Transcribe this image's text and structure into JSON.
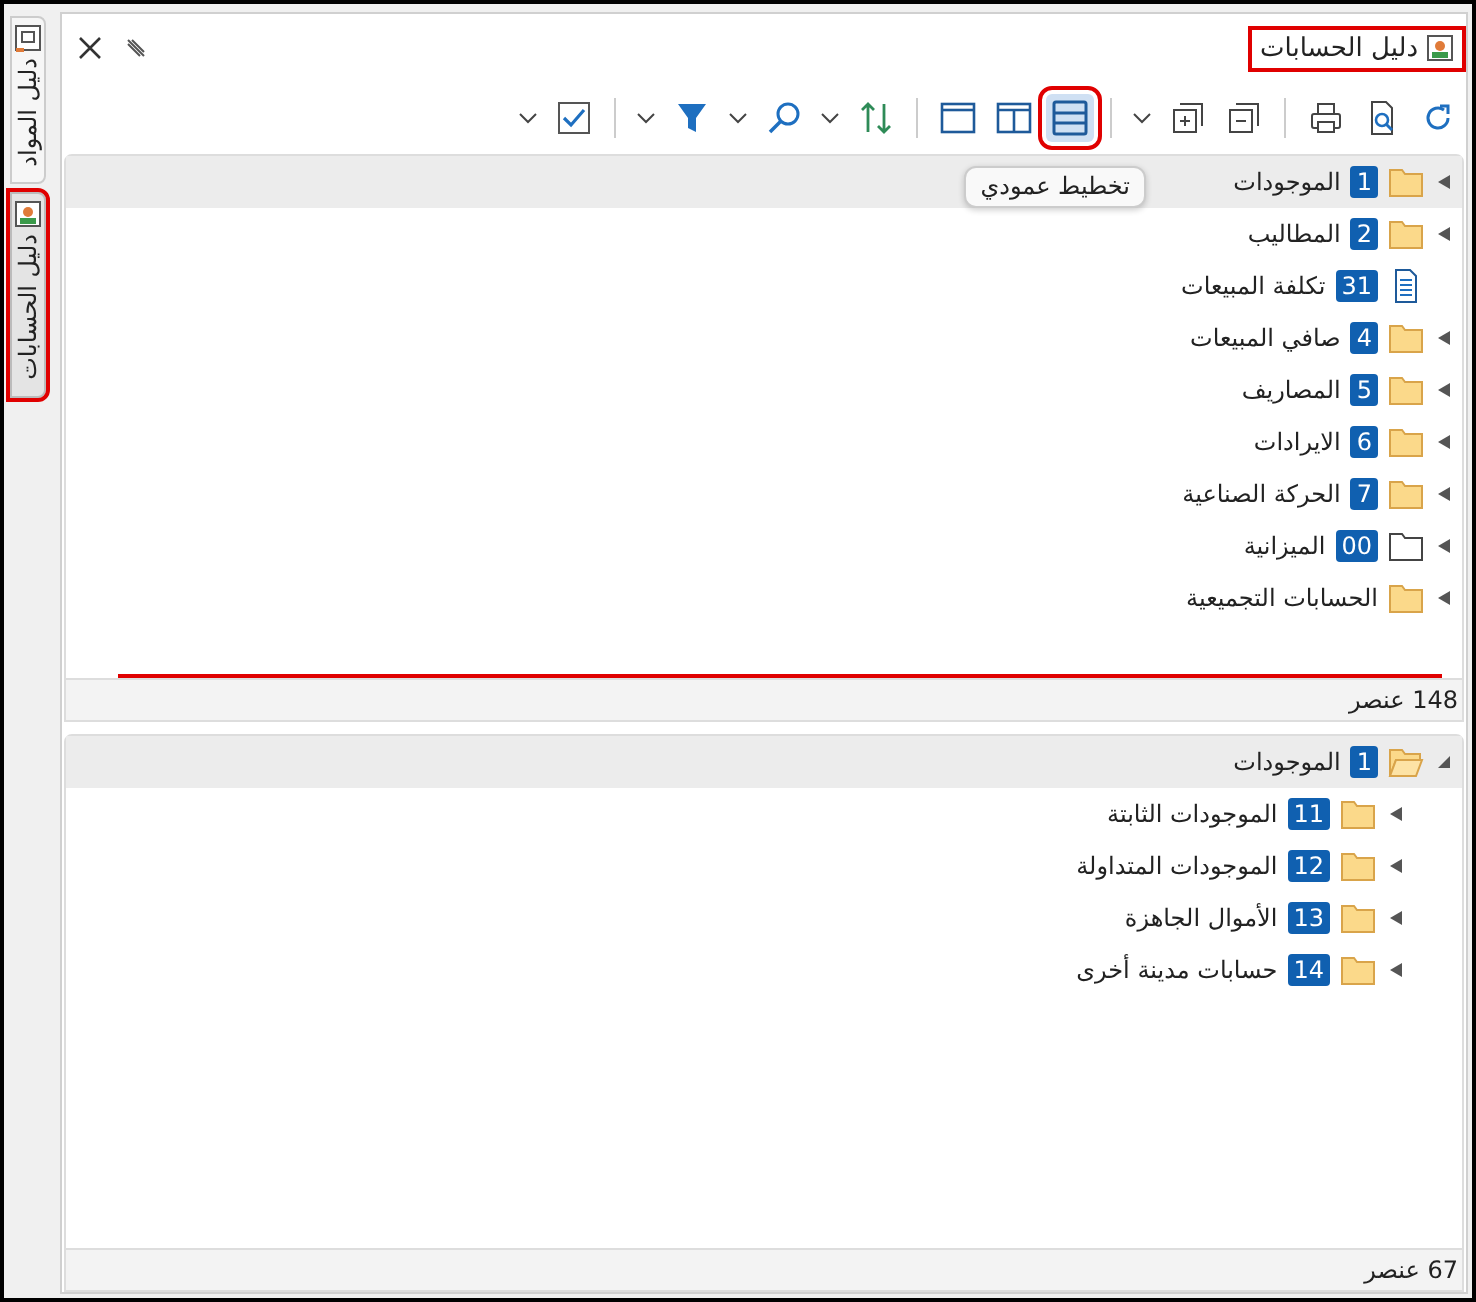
{
  "sidebar_tabs": [
    {
      "label": "دليل المواد",
      "selected": false,
      "highlighted": false
    },
    {
      "label": "دليل الحسابات",
      "selected": true,
      "highlighted": true
    }
  ],
  "panel": {
    "title": "دليل الحسابات",
    "title_highlighted": true
  },
  "toolbar": [
    {
      "kind": "refresh"
    },
    {
      "kind": "print-preview"
    },
    {
      "kind": "print"
    },
    {
      "kind": "separator"
    },
    {
      "kind": "collapse"
    },
    {
      "kind": "expand"
    },
    {
      "kind": "dropdown"
    },
    {
      "kind": "separator"
    },
    {
      "kind": "layout-rows",
      "selected": true,
      "highlighted": true
    },
    {
      "kind": "layout-columns",
      "selected": false,
      "highlighted": false
    },
    {
      "kind": "layout-single",
      "selected": false,
      "highlighted": false
    },
    {
      "kind": "separator"
    },
    {
      "kind": "sort"
    },
    {
      "kind": "dropdown"
    },
    {
      "kind": "search"
    },
    {
      "kind": "dropdown"
    },
    {
      "kind": "filter"
    },
    {
      "kind": "dropdown"
    },
    {
      "kind": "separator"
    },
    {
      "kind": "check"
    },
    {
      "kind": "dropdown"
    }
  ],
  "tooltip": "تخطيط عمودي",
  "upper_tree": {
    "rows": [
      {
        "code": "1",
        "label": "الموجودات",
        "kind": "folder",
        "selected": true,
        "expanded": false
      },
      {
        "code": "2",
        "label": "المطاليب",
        "kind": "folder",
        "selected": false,
        "expanded": false
      },
      {
        "code": "31",
        "label": "تكلفة المبيعات",
        "kind": "document",
        "selected": false
      },
      {
        "code": "4",
        "label": "صافي المبيعات",
        "kind": "folder",
        "selected": false,
        "expanded": false
      },
      {
        "code": "5",
        "label": "المصاريف",
        "kind": "folder",
        "selected": false,
        "expanded": false
      },
      {
        "code": "6",
        "label": "الايرادات",
        "kind": "folder",
        "selected": false,
        "expanded": false
      },
      {
        "code": "7",
        "label": "الحركة الصناعية",
        "kind": "folder",
        "selected": false,
        "expanded": false
      },
      {
        "code": "00",
        "label": "الميزانية",
        "kind": "empty-folder",
        "selected": false,
        "expanded": false
      },
      {
        "label": "الحسابات التجميعية",
        "kind": "folder",
        "selected": false,
        "expanded": false
      }
    ],
    "divider_marked": true,
    "status": "148 عنصر"
  },
  "lower_tree": {
    "rows": [
      {
        "code": "1",
        "label": "الموجودات",
        "kind": "folder",
        "selected": true,
        "expanded": true,
        "children": [
          {
            "code": "11",
            "label": "الموجودات الثابتة",
            "kind": "folder",
            "selected": false,
            "expanded": false
          },
          {
            "code": "12",
            "label": "الموجودات المتداولة",
            "kind": "folder",
            "selected": false,
            "expanded": false
          },
          {
            "code": "13",
            "label": "الأموال الجاهزة",
            "kind": "folder",
            "selected": false,
            "expanded": false
          },
          {
            "code": "14",
            "label": "حسابات مدينة أخرى",
            "kind": "folder",
            "selected": false,
            "expanded": false
          }
        ]
      }
    ],
    "status": "67 عنصر"
  }
}
